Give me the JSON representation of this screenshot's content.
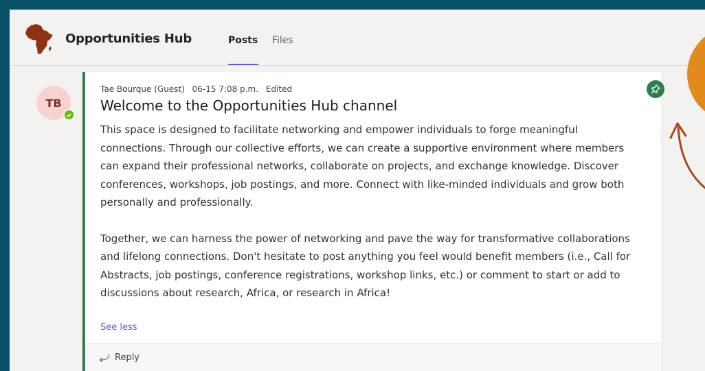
{
  "channel": {
    "name": "Opportunities Hub",
    "tabs": [
      {
        "label": "Posts",
        "active": true
      },
      {
        "label": "Files",
        "active": false
      }
    ]
  },
  "post": {
    "avatar_initials": "TB",
    "author": "Tae Bourque (Guest)",
    "timestamp": "06-15 7:08 p.m.",
    "edited": "Edited",
    "title": "Welcome to the Opportunities Hub channel",
    "paragraphs": [
      "This space is designed to facilitate networking and empower individuals to forge meaningful connections. Through our collective efforts, we can create a supportive environment where members can expand their professional networks, collaborate on projects, and exchange knowledge. Discover conferences, workshops, job postings, and more. Connect with like-minded individuals and grow both personally and professionally.",
      "Together, we can harness the power of networking and pave the way for transformative collaborations and lifelong connections. Don't hesitate to post anything you feel would benefit members (i.e., Call for Abstracts, job postings, conference registrations, workshop links, etc.) or comment to start or add to discussions about research, Africa, or research in Africa!"
    ],
    "see_less": "See less",
    "reply": "Reply"
  },
  "icons": [
    "africa-logo-icon",
    "pin-icon",
    "reply-arrow-icon",
    "presence-available-icon"
  ],
  "colors": {
    "outer_background": "#0a5068",
    "accent": "#5b5fc7",
    "post_border": "#2e7d4c",
    "pin_badge": "#2e7d4c",
    "annotation_circle": "#e28a1c",
    "annotation_arrow": "#a8461a"
  }
}
